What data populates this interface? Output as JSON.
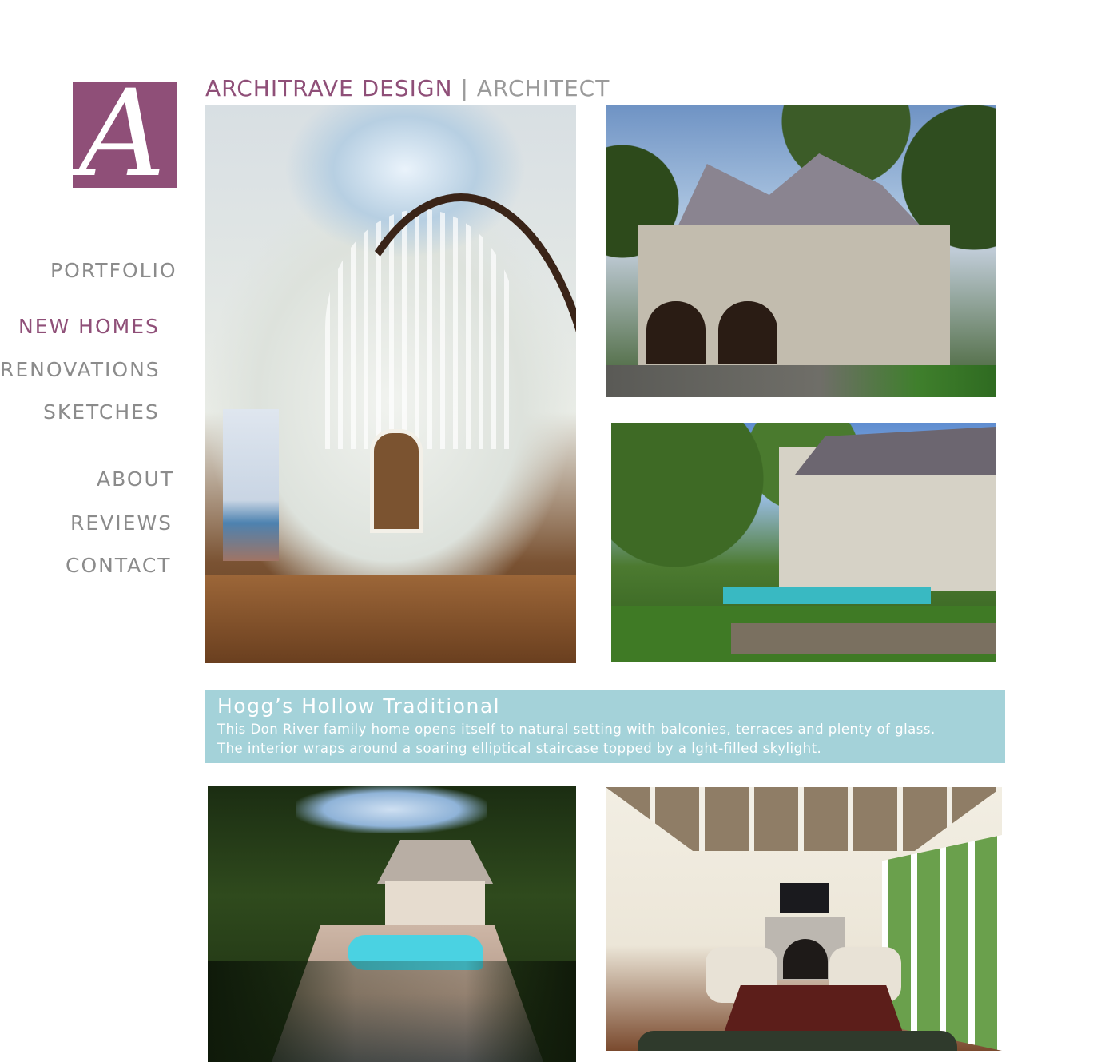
{
  "logo": {
    "letter": "A",
    "color": "#8f4f78"
  },
  "header": {
    "brand_name": "ARCHITRAVE DESIGN",
    "separator": " | ",
    "role": "ARCHITECT"
  },
  "nav": {
    "portfolio": "PORTFOLIO",
    "new_homes": "NEW HOMES",
    "renovations": "RENOVATIONS",
    "sketches": "SKETCHES",
    "about": "ABOUT",
    "reviews": "REVIEWS",
    "contact": "CONTACT",
    "active_item": "NEW HOMES"
  },
  "project": {
    "title": "Hogg’s Hollow Traditional",
    "description_line1": "This Don River family home opens itself to natural setting with balconies, terraces and plenty of glass.",
    "description_line2": "The interior wraps around a soaring elliptical staircase topped by a lght-filled skylight."
  },
  "colors": {
    "accent": "#8f4f78",
    "nav_text": "#8b8b8b",
    "banner_bg": "#a4d2d9"
  }
}
